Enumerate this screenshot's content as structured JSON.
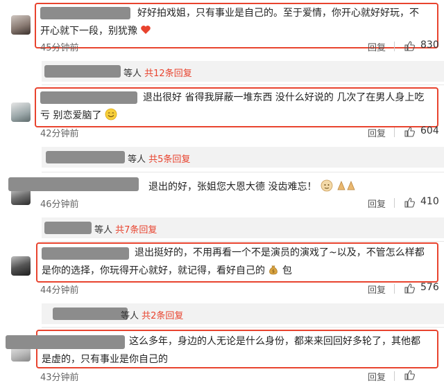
{
  "comments": [
    {
      "text_line1": "好好拍戏姐，只有事业是自己的。至于爱情，你开心就好好玩，不",
      "text_line2": "开心就下一段，别犹豫",
      "time": "45分钟前",
      "reply_label": "回复",
      "likes": "830",
      "sub_suffix": "等人",
      "sub_link": "共12条回复"
    },
    {
      "text_line1": "退出很好 省得我屏蔽一堆东西 没什么好说的 几次了在男人身上吃",
      "text_line2": "亏 别恋爱脑了",
      "time": "42分钟前",
      "reply_label": "回复",
      "likes": "604",
      "sub_suffix": "等人",
      "sub_link": "共5条回复"
    },
    {
      "text_line1": "退出的好，张姐您大恩大德 没齿难忘！",
      "time": "46分钟前",
      "reply_label": "回复",
      "likes": "410",
      "sub_suffix": "等人",
      "sub_link": "共7条回复"
    },
    {
      "text_line1": "退出挺好的，不用再看一个不是演员的演戏了~以及，不管怎么样都",
      "text_line2": "是你的选择，你玩得开心就好，就记得，看好自己的",
      "text_line2_tail": "包",
      "time": "44分钟前",
      "reply_label": "回复",
      "likes": "576",
      "sub_suffix": "等人",
      "sub_link": "共2条回复"
    },
    {
      "text_line1": "这么多年，身边的人无论是什么身份，都来来回回好多轮了，其他都",
      "text_line2": "是虚的，只有事业是你自己的",
      "time": "43分钟前",
      "reply_label": "回复",
      "likes": "",
      "sub_suffix": "",
      "sub_link": ""
    }
  ],
  "colors": {
    "accent": "#e8432e",
    "strip": "#f2f2f2",
    "blur": "#8c8c8c"
  },
  "icons": {
    "like": "thumbs-up-icon",
    "heart": "heart-emoji",
    "smile": "smile-emoji",
    "money": "money-bag-emoji"
  }
}
